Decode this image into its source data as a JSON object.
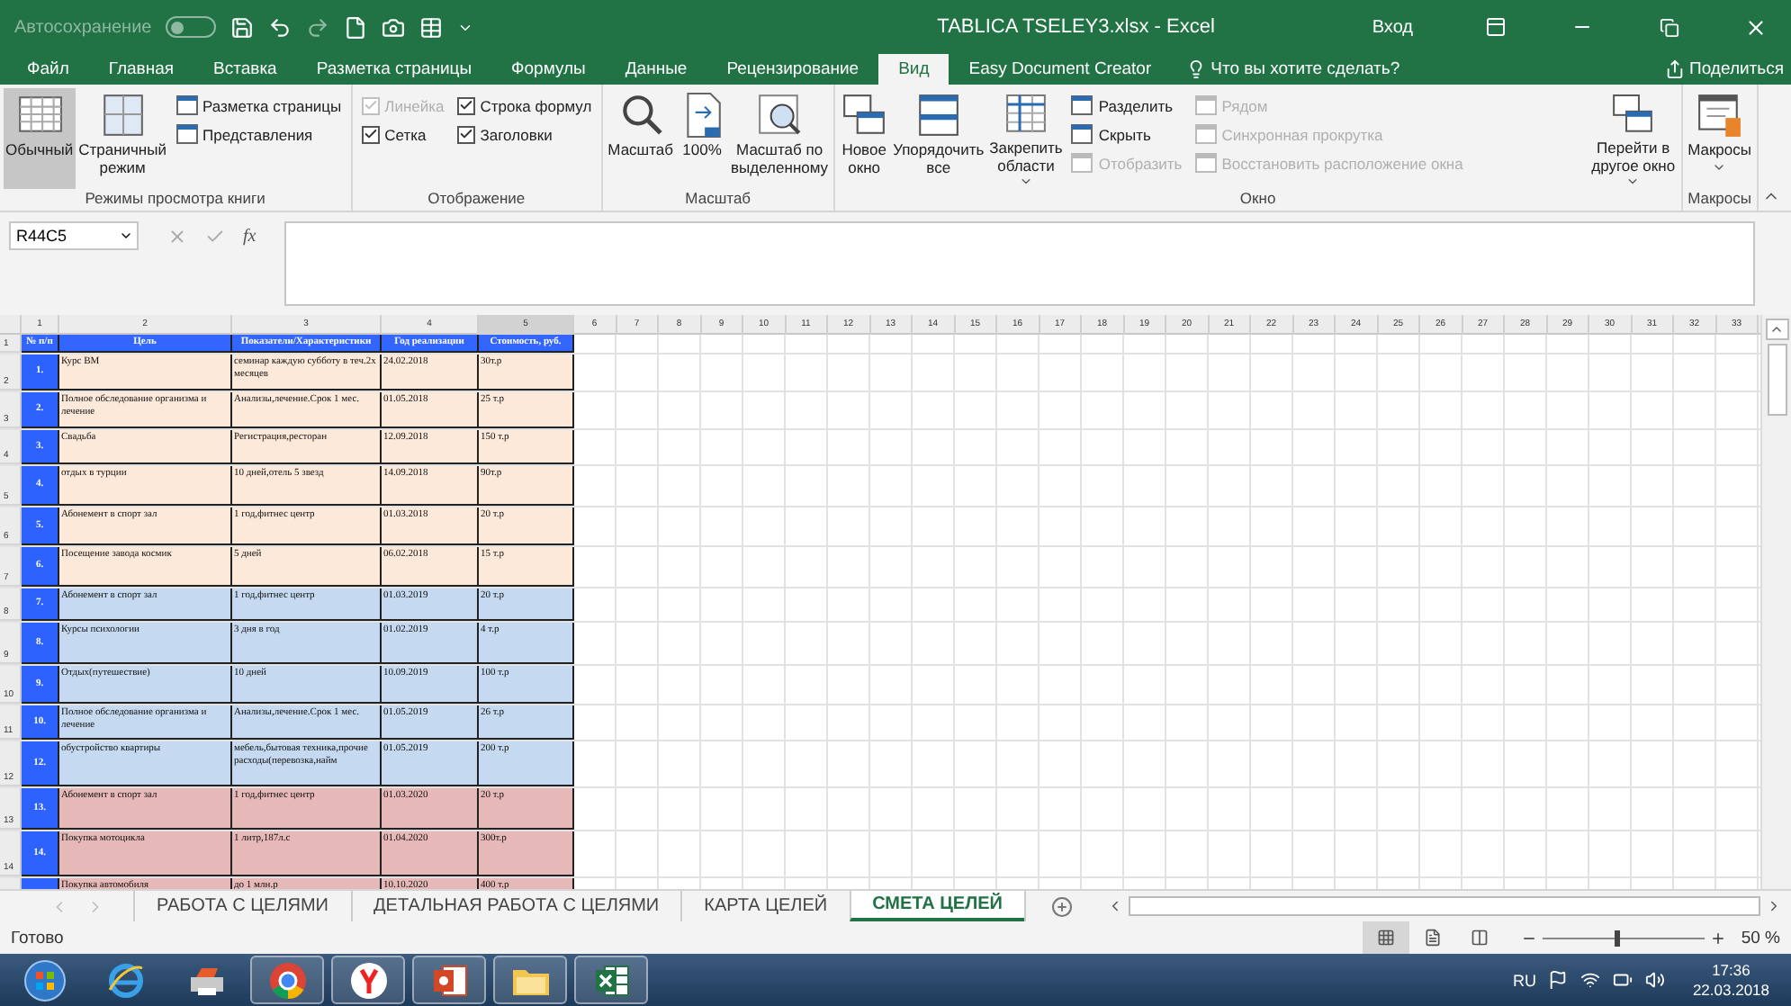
{
  "title_bar": {
    "autosave_label": "Автосохранение",
    "autosave_on": false,
    "title": "TABLICA TSELEY3.xlsx  -  Excel",
    "signin": "Вход"
  },
  "tabs": [
    {
      "label": "Файл",
      "selected": false
    },
    {
      "label": "Главная",
      "selected": false
    },
    {
      "label": "Вставка",
      "selected": false
    },
    {
      "label": "Разметка страницы",
      "selected": false
    },
    {
      "label": "Формулы",
      "selected": false
    },
    {
      "label": "Данные",
      "selected": false
    },
    {
      "label": "Рецензирование",
      "selected": false
    },
    {
      "label": "Вид",
      "selected": true
    },
    {
      "label": "Easy Document Creator",
      "selected": false
    }
  ],
  "tell_me": "Что вы хотите сделать?",
  "share": "Поделиться",
  "ribbon": {
    "groups": [
      {
        "label": "Режимы просмотра книги",
        "items": [
          {
            "kind": "large",
            "label": "Обычный",
            "selected": true
          },
          {
            "kind": "large",
            "label": "Страничный\nрежим",
            "selected": false
          },
          {
            "kind": "stack",
            "items": [
              {
                "kind": "small",
                "label": "Разметка страницы",
                "disabled": false
              },
              {
                "kind": "small",
                "label": "Представления",
                "disabled": false
              }
            ]
          }
        ]
      },
      {
        "label": "Отображение",
        "items": [
          {
            "kind": "stack",
            "items": [
              {
                "kind": "check",
                "label": "Линейка",
                "checked": true,
                "disabled": true
              },
              {
                "kind": "check",
                "label": "Сетка",
                "checked": true,
                "disabled": false
              }
            ]
          },
          {
            "kind": "stack",
            "items": [
              {
                "kind": "check",
                "label": "Строка формул",
                "checked": true,
                "disabled": false
              },
              {
                "kind": "check",
                "label": "Заголовки",
                "checked": true,
                "disabled": false
              }
            ]
          }
        ]
      },
      {
        "label": "Масштаб",
        "items": [
          {
            "kind": "large",
            "label": "Масштаб"
          },
          {
            "kind": "large",
            "label": "100%"
          },
          {
            "kind": "large",
            "label": "Масштаб по\nвыделенному"
          }
        ]
      },
      {
        "label": "Окно",
        "items": [
          {
            "kind": "large",
            "label": "Новое\nокно"
          },
          {
            "kind": "large",
            "label": "Упорядочить\nвсе"
          },
          {
            "kind": "large",
            "label": "Закрепить\nобласти",
            "dropdown": true
          },
          {
            "kind": "stack",
            "items": [
              {
                "kind": "small",
                "label": "Разделить",
                "disabled": false
              },
              {
                "kind": "small",
                "label": "Скрыть",
                "disabled": false
              },
              {
                "kind": "small",
                "label": "Отобразить",
                "disabled": true
              }
            ]
          },
          {
            "kind": "stack",
            "items": [
              {
                "kind": "small",
                "label": "Рядом",
                "disabled": true
              },
              {
                "kind": "small",
                "label": "Синхронная прокрутка",
                "disabled": true
              },
              {
                "kind": "small",
                "label": "Восстановить расположение окна",
                "disabled": true
              }
            ]
          },
          {
            "kind": "large",
            "label": "Перейти в\nдругое окно",
            "dropdown": true
          }
        ]
      },
      {
        "label": "Макросы",
        "items": [
          {
            "kind": "large",
            "label": "Макросы",
            "dropdown": true
          }
        ]
      }
    ]
  },
  "formula_bar": {
    "name_box": "R44C5",
    "fx": "fx"
  },
  "sheet": {
    "column_headers": [
      "1",
      "2",
      "3",
      "4",
      "5",
      "6",
      "7",
      "8",
      "9",
      "10",
      "11",
      "12",
      "13",
      "14",
      "15",
      "16",
      "17",
      "18",
      "19",
      "20",
      "21",
      "22",
      "23",
      "24",
      "25",
      "26",
      "27",
      "28",
      "29",
      "30",
      "31",
      "32",
      "33"
    ],
    "header_row": {
      "row": "1",
      "cells": [
        "№ п/п",
        "Цель",
        "Показатели/Характеристики",
        "Год реализации",
        "Стоимость, руб."
      ]
    },
    "rows": [
      {
        "row": "2",
        "color": "#fde9d9",
        "cells": [
          "1.",
          "Курс ВМ",
          "семинар каждую субботу в теч.2х месяцев",
          "24.02.2018",
          "30т.р"
        ]
      },
      {
        "row": "3",
        "color": "#fde9d9",
        "cells": [
          "2.",
          "Полное обследование организма и лечение",
          "Анализы,лечение.Срок 1 мес.",
          "01.05.2018",
          "25 т.р"
        ]
      },
      {
        "row": "4",
        "color": "#fde9d9",
        "cells": [
          "3.",
          "Свадьба",
          "Регистрация,ресторан",
          "12.09.2018",
          "150 т.р"
        ]
      },
      {
        "row": "5",
        "color": "#fde9d9",
        "cells": [
          "4.",
          "отдых в турции",
          "10 дней,отель 5 звезд",
          "14.09.2018",
          "90т.р"
        ]
      },
      {
        "row": "6",
        "color": "#fde9d9",
        "cells": [
          "5.",
          "Абонемент в спорт зал",
          "1 год,фитнес центр",
          "01.03.2018",
          "20 т.р"
        ]
      },
      {
        "row": "7",
        "color": "#fde9d9",
        "cells": [
          "6.",
          "Посещение завода космик",
          "5 дней",
          "06.02.2018",
          "15 т.р"
        ]
      },
      {
        "row": "8",
        "color": "#c5d9f1",
        "cells": [
          "7.",
          "Абонемент в спорт зал",
          "1 год,фитнес центр",
          "01.03.2019",
          "20 т.р"
        ]
      },
      {
        "row": "9",
        "color": "#c5d9f1",
        "cells": [
          "8.",
          "Курсы психологии",
          "3 дня в год",
          "01.02.2019",
          "4 т.р"
        ]
      },
      {
        "row": "10",
        "color": "#c5d9f1",
        "cells": [
          "9.",
          "Отдых(путешествие)",
          "10 дней",
          "10.09.2019",
          "100 т.р"
        ]
      },
      {
        "row": "11",
        "color": "#c5d9f1",
        "cells": [
          "10.",
          "Полное обследование организма и лечение",
          "Анализы,лечение.Срок 1 мес.",
          "01.05.2019",
          "26 т.р"
        ]
      },
      {
        "row": "12",
        "color": "#c5d9f1",
        "cells": [
          "12.",
          "обустройство квартиры",
          "мебель,бытовая техника,прочие расходы(перевозка,найм",
          "01.05.2019",
          "200 т.р"
        ]
      },
      {
        "row": "13",
        "color": "#e6b8b7",
        "cells": [
          "13.",
          "Абонемент в спорт зал",
          "1 год,фитнес центр",
          "01.03.2020",
          "20 т.р"
        ]
      },
      {
        "row": "14",
        "color": "#e6b8b7",
        "cells": [
          "14.",
          "Покупка мотоцикла",
          "1 литр,187л.с",
          "01.04.2020",
          "300т.р"
        ]
      },
      {
        "color": "#e6b8b7",
        "cells": [
          "",
          "Покупка автомобиля",
          "до 1 млн.р",
          "10.10.2020",
          "400 т.р"
        ]
      }
    ]
  },
  "sheet_tabs": [
    {
      "label": "РАБОТА С ЦЕЛЯМИ",
      "selected": false
    },
    {
      "label": "ДЕТАЛЬНАЯ РАБОТА С ЦЕЛЯМИ",
      "selected": false
    },
    {
      "label": "КАРТА ЦЕЛЕЙ",
      "selected": false
    },
    {
      "label": "СМЕТА ЦЕЛЕЙ",
      "selected": true
    }
  ],
  "status_bar": {
    "status": "Готово",
    "views": [
      {
        "selected": true
      },
      {
        "selected": false
      },
      {
        "selected": false
      }
    ],
    "zoom": {
      "level": 0.45,
      "reading": "50 %"
    }
  },
  "taskbar": {
    "apps": [
      {
        "running": false
      },
      {
        "running": false
      },
      {
        "running": false
      },
      {
        "running": true
      },
      {
        "running": true
      },
      {
        "running": true
      },
      {
        "running": true
      },
      {
        "running": true
      }
    ],
    "language": "RU",
    "time": "17:36",
    "date": "22.03.2018"
  }
}
